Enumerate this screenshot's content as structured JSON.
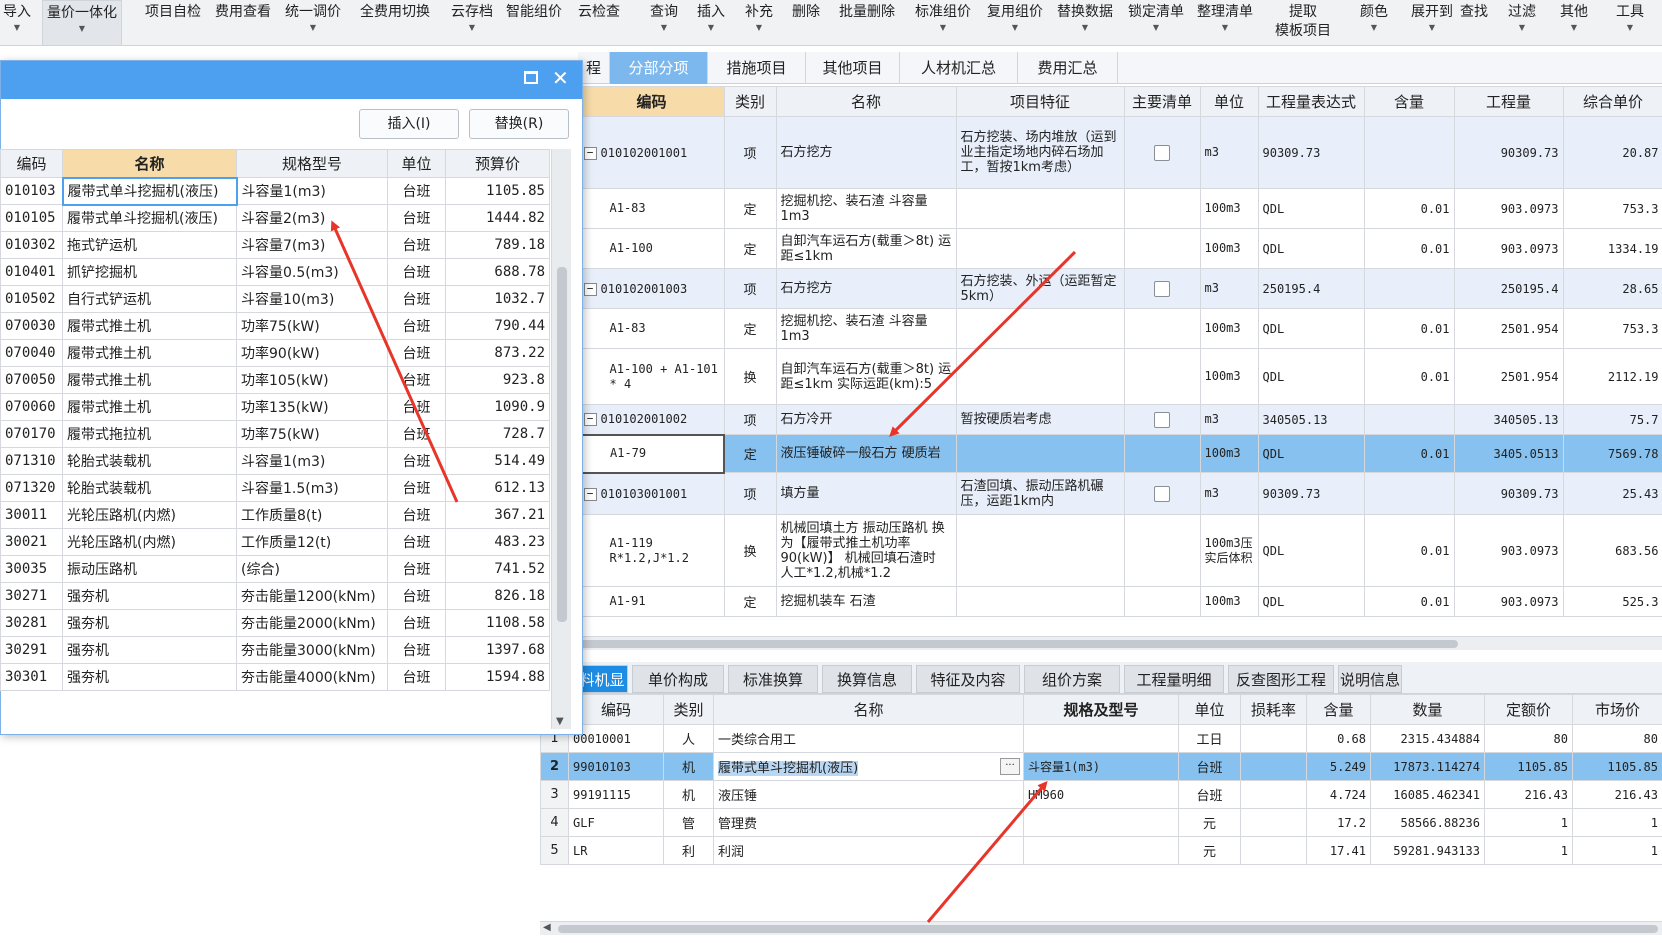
{
  "toolbar": [
    {
      "label": "导入",
      "arrow": true
    },
    {
      "label": "量价一体化",
      "arrow": true,
      "highlight": true
    },
    {
      "label": "项目自检",
      "arrow": false
    },
    {
      "label": "费用查看",
      "arrow": false
    },
    {
      "label": "统一调价",
      "arrow": true
    },
    {
      "label": "全费用切换",
      "arrow": false
    },
    {
      "label": "云存档",
      "arrow": true
    },
    {
      "label": "智能组价",
      "arrow": false
    },
    {
      "label": "云检查",
      "arrow": false
    },
    {
      "label": "查询",
      "arrow": true
    },
    {
      "label": "插入",
      "arrow": true
    },
    {
      "label": "补充",
      "arrow": true
    },
    {
      "label": "删除",
      "arrow": false
    },
    {
      "label": "批量删除",
      "arrow": false
    },
    {
      "label": "标准组价",
      "arrow": true
    },
    {
      "label": "复用组价",
      "arrow": true
    },
    {
      "label": "替换数据",
      "arrow": true
    },
    {
      "label": "锁定清单",
      "arrow": true
    },
    {
      "label": "整理清单",
      "arrow": true
    },
    {
      "label": "提取\n模板项目",
      "arrow": false
    },
    {
      "label": "颜色",
      "arrow": true
    },
    {
      "label": "展开到",
      "arrow": true
    },
    {
      "label": "查找",
      "arrow": false
    },
    {
      "label": "过滤",
      "arrow": true
    },
    {
      "label": "其他",
      "arrow": true
    },
    {
      "label": "工具",
      "arrow": true
    }
  ],
  "top_tabs": [
    {
      "label": "程"
    },
    {
      "label": "分部分项",
      "active": true
    },
    {
      "label": "措施项目"
    },
    {
      "label": "其他项目"
    },
    {
      "label": "人材机汇总"
    },
    {
      "label": "费用汇总"
    }
  ],
  "main_table": {
    "headers": [
      "编码",
      "类别",
      "名称",
      "项目特征",
      "主要清单",
      "单位",
      "工程量表达式",
      "含量",
      "工程量",
      "综合单价"
    ],
    "rows": [
      {
        "type": "item",
        "code": "010102001001",
        "cat": "项",
        "name": "石方挖方",
        "feature": "石方挖装、场内堆放（运到业主指定场地内碎石场加工，暂按1km考虑）",
        "unit": "m3",
        "expr": "90309.73",
        "content": "",
        "qty": "90309.73",
        "price": "20.87"
      },
      {
        "type": "sub",
        "code": "A1-83",
        "cat": "定",
        "name": "挖掘机挖、装石渣 斗容量1m3",
        "feature": "",
        "unit": "100m3",
        "expr": "QDL",
        "content": "0.01",
        "qty": "903.0973",
        "price": "753.3"
      },
      {
        "type": "sub",
        "code": "A1-100",
        "cat": "定",
        "name": "自卸汽车运石方(载重＞8t) 运距≤1km",
        "feature": "",
        "unit": "100m3",
        "expr": "QDL",
        "content": "0.01",
        "qty": "903.0973",
        "price": "1334.19"
      },
      {
        "type": "item",
        "code": "010102001003",
        "cat": "项",
        "name": "石方挖方",
        "feature": "石方挖装、外运（运距暂定5km）",
        "unit": "m3",
        "expr": "250195.4",
        "content": "",
        "qty": "250195.4",
        "price": "28.65"
      },
      {
        "type": "sub",
        "code": "A1-83",
        "cat": "定",
        "name": "挖掘机挖、装石渣 斗容量1m3",
        "feature": "",
        "unit": "100m3",
        "expr": "QDL",
        "content": "0.01",
        "qty": "2501.954",
        "price": "753.3"
      },
      {
        "type": "sub",
        "code": "A1-100 + A1-101 * 4",
        "cat": "换",
        "name": "自卸汽车运石方(载重＞8t) 运距≤1km  实际运距(km):5",
        "feature": "",
        "unit": "100m3",
        "expr": "QDL",
        "content": "0.01",
        "qty": "2501.954",
        "price": "2112.19"
      },
      {
        "type": "item",
        "code": "010102001002",
        "cat": "项",
        "name": "石方冷开",
        "feature": "暂按硬质岩考虑",
        "unit": "m3",
        "expr": "340505.13",
        "content": "",
        "qty": "340505.13",
        "price": "75.7"
      },
      {
        "type": "selected",
        "code": "A1-79",
        "cat": "定",
        "name": "液压锤破碎一般石方 硬质岩",
        "feature": "",
        "unit": "100m3",
        "expr": "QDL",
        "content": "0.01",
        "qty": "3405.0513",
        "price": "7569.78"
      },
      {
        "type": "item",
        "code": "010103001001",
        "cat": "项",
        "name": "填方量",
        "feature": "石渣回填、振动压路机碾压，运距1km内",
        "unit": "m3",
        "expr": "90309.73",
        "content": "",
        "qty": "90309.73",
        "price": "25.43"
      },
      {
        "type": "sub",
        "code": "A1-119 R*1.2,J*1.2",
        "cat": "换",
        "name": "机械回填土方 振动压路机 换为【履带式推土机功率90(kW)】 机械回填石渣时 人工*1.2,机械*1.2",
        "feature": "",
        "unit": "100m3压实后体积",
        "expr": "QDL",
        "content": "0.01",
        "qty": "903.0973",
        "price": "683.56"
      },
      {
        "type": "sub",
        "code": "A1-91",
        "cat": "定",
        "name": "挖掘机装车 石渣",
        "feature": "",
        "unit": "100m3",
        "expr": "QDL",
        "content": "0.01",
        "qty": "903.0973",
        "price": "525.3"
      }
    ]
  },
  "bottom_tabs": [
    {
      "label": "料机显示",
      "active": true
    },
    {
      "label": "单价构成"
    },
    {
      "label": "标准换算"
    },
    {
      "label": "换算信息"
    },
    {
      "label": "特征及内容"
    },
    {
      "label": "组价方案"
    },
    {
      "label": "工程量明细"
    },
    {
      "label": "反查图形工程量"
    },
    {
      "label": "说明信息"
    }
  ],
  "resource_table": {
    "headers": [
      "编码",
      "类别",
      "名称",
      "规格及型号",
      "单位",
      "损耗率",
      "含量",
      "数量",
      "定额价",
      "市场价"
    ],
    "rows": [
      {
        "n": "1",
        "code": "00010001",
        "cat": "人",
        "name": "一类综合用工",
        "spec": "",
        "unit": "工日",
        "loss": "",
        "content": "0.68",
        "qty": "2315.434884",
        "base": "80",
        "market": "80"
      },
      {
        "n": "2",
        "code": "99010103",
        "cat": "机",
        "name": "履带式单斗挖掘机(液压)",
        "spec": "斗容量1(m3)",
        "unit": "台班",
        "loss": "",
        "content": "5.249",
        "qty": "17873.114274",
        "base": "1105.85",
        "market": "1105.85",
        "selected": true
      },
      {
        "n": "3",
        "code": "99191115",
        "cat": "机",
        "name": "液压锤",
        "spec": "HM960",
        "unit": "台班",
        "loss": "",
        "content": "4.724",
        "qty": "16085.462341",
        "base": "216.43",
        "market": "216.43"
      },
      {
        "n": "4",
        "code": "GLF",
        "cat": "管",
        "name": "管理费",
        "spec": "",
        "unit": "元",
        "loss": "",
        "content": "17.2",
        "qty": "58566.88236",
        "base": "1",
        "market": "1"
      },
      {
        "n": "5",
        "code": "LR",
        "cat": "利",
        "name": "利润",
        "spec": "",
        "unit": "元",
        "loss": "",
        "content": "17.41",
        "qty": "59281.943133",
        "base": "1",
        "market": "1"
      }
    ]
  },
  "dialog": {
    "insert_label": "插入(I)",
    "replace_label": "替换(R)",
    "headers": [
      "编码",
      "名称",
      "规格型号",
      "单位",
      "预算价"
    ],
    "rows": [
      {
        "code": "010103",
        "name": "履带式单斗挖掘机(液压)",
        "spec": "斗容量1(m3)",
        "unit": "台班",
        "price": "1105.85",
        "selected": true
      },
      {
        "code": "010105",
        "name": "履带式单斗挖掘机(液压)",
        "spec": "斗容量2(m3)",
        "unit": "台班",
        "price": "1444.82"
      },
      {
        "code": "010302",
        "name": "拖式铲运机",
        "spec": "斗容量7(m3)",
        "unit": "台班",
        "price": "789.18"
      },
      {
        "code": "010401",
        "name": "抓铲挖掘机",
        "spec": "斗容量0.5(m3)",
        "unit": "台班",
        "price": "688.78"
      },
      {
        "code": "010502",
        "name": "自行式铲运机",
        "spec": "斗容量10(m3)",
        "unit": "台班",
        "price": "1032.7"
      },
      {
        "code": "070030",
        "name": "履带式推土机",
        "spec": "功率75(kW)",
        "unit": "台班",
        "price": "790.44"
      },
      {
        "code": "070040",
        "name": "履带式推土机",
        "spec": "功率90(kW)",
        "unit": "台班",
        "price": "873.22"
      },
      {
        "code": "070050",
        "name": "履带式推土机",
        "spec": "功率105(kW)",
        "unit": "台班",
        "price": "923.8"
      },
      {
        "code": "070060",
        "name": "履带式推土机",
        "spec": "功率135(kW)",
        "unit": "台班",
        "price": "1090.9"
      },
      {
        "code": "070170",
        "name": "履带式拖拉机",
        "spec": "功率75(kW)",
        "unit": "台班",
        "price": "728.7"
      },
      {
        "code": "071310",
        "name": "轮胎式装载机",
        "spec": "斗容量1(m3)",
        "unit": "台班",
        "price": "514.49"
      },
      {
        "code": "071320",
        "name": "轮胎式装载机",
        "spec": "斗容量1.5(m3)",
        "unit": "台班",
        "price": "612.13"
      },
      {
        "code": "30011",
        "name": "光轮压路机(内燃)",
        "spec": "工作质量8(t)",
        "unit": "台班",
        "price": "367.21"
      },
      {
        "code": "30021",
        "name": "光轮压路机(内燃)",
        "spec": "工作质量12(t)",
        "unit": "台班",
        "price": "483.23"
      },
      {
        "code": "30035",
        "name": "振动压路机",
        "spec": "(综合)",
        "unit": "台班",
        "price": "741.52"
      },
      {
        "code": "30271",
        "name": "强夯机",
        "spec": "夯击能量1200(kNm)",
        "unit": "台班",
        "price": "826.18"
      },
      {
        "code": "30281",
        "name": "强夯机",
        "spec": "夯击能量2000(kNm)",
        "unit": "台班",
        "price": "1108.58"
      },
      {
        "code": "30291",
        "name": "强夯机",
        "spec": "夯击能量3000(kNm)",
        "unit": "台班",
        "price": "1397.68"
      },
      {
        "code": "30301",
        "name": "强夯机",
        "spec": "夯击能量4000(kNm)",
        "unit": "台班",
        "price": "1594.88"
      }
    ]
  },
  "colors": {
    "accent": "#4d9ff0",
    "selected_row": "#87c1ef",
    "active_tab": "#1e8ce3",
    "arrow": "#e8352a",
    "item_row": "#e8effa"
  }
}
